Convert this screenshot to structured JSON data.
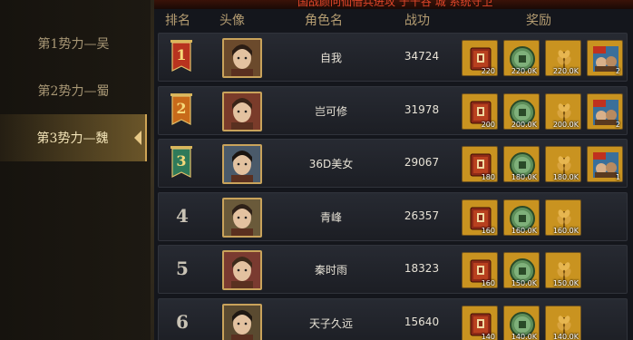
{
  "banner": {
    "text": "国战颜问仙借兵进攻 于千谷 城 系统守卫"
  },
  "sidebar": {
    "tabs": [
      {
        "label": "第1势力—吴"
      },
      {
        "label": "第2势力—蜀"
      },
      {
        "label": "第3势力—魏"
      }
    ],
    "active_index": 2
  },
  "table": {
    "headers": {
      "rank": "排名",
      "avatar": "头像",
      "name": "角色名",
      "power": "战功",
      "reward": "奖励"
    },
    "rows": [
      {
        "rank": "1",
        "name": "自我",
        "power": "34724",
        "flag_color": "#b8331f",
        "rewards": [
          {
            "type": "book-icon",
            "qty": "220"
          },
          {
            "type": "coin-icon",
            "qty": "220.0K"
          },
          {
            "type": "wheat-icon",
            "qty": "220.0K"
          },
          {
            "type": "vip-card-icon",
            "qty": "2"
          }
        ]
      },
      {
        "rank": "2",
        "name": "岂可修",
        "power": "31978",
        "flag_color": "#c86a1a",
        "rewards": [
          {
            "type": "book-icon",
            "qty": "200"
          },
          {
            "type": "coin-icon",
            "qty": "200.0K"
          },
          {
            "type": "wheat-icon",
            "qty": "200.0K"
          },
          {
            "type": "vip-card-icon",
            "qty": "2"
          }
        ]
      },
      {
        "rank": "3",
        "name": "36D美女",
        "power": "29067",
        "flag_color": "#2f7a5a",
        "rewards": [
          {
            "type": "book-icon",
            "qty": "180"
          },
          {
            "type": "coin-icon",
            "qty": "180.0K"
          },
          {
            "type": "wheat-icon",
            "qty": "180.0K"
          },
          {
            "type": "vip-card-icon",
            "qty": "1"
          }
        ]
      },
      {
        "rank": "4",
        "name": "青峰",
        "power": "26357",
        "rewards": [
          {
            "type": "book-icon",
            "qty": "160"
          },
          {
            "type": "coin-icon",
            "qty": "160.0K"
          },
          {
            "type": "wheat-icon",
            "qty": "160.0K"
          }
        ]
      },
      {
        "rank": "5",
        "name": "秦时雨",
        "power": "18323",
        "rewards": [
          {
            "type": "book-icon",
            "qty": "160"
          },
          {
            "type": "coin-icon",
            "qty": "150.0K"
          },
          {
            "type": "wheat-icon",
            "qty": "150.0K"
          }
        ]
      },
      {
        "rank": "6",
        "name": "天子久远",
        "power": "15640",
        "rewards": [
          {
            "type": "book-icon",
            "qty": "140"
          },
          {
            "type": "coin-icon",
            "qty": "140.0K"
          },
          {
            "type": "wheat-icon",
            "qty": "140.0K"
          }
        ]
      }
    ]
  },
  "colors": {
    "accent_gold": "#cfa555",
    "reward_bg": "#c99320",
    "text_header": "#b59d72"
  }
}
